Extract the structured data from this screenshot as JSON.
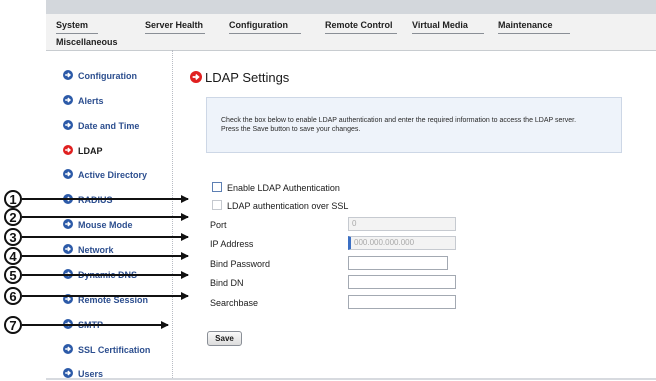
{
  "menu": {
    "items": [
      "System",
      "Server Health",
      "Configuration",
      "Remote Control",
      "Virtual Media",
      "Maintenance"
    ],
    "row2": [
      "Miscellaneous"
    ]
  },
  "sidebar": {
    "items": [
      {
        "label": "Configuration",
        "icon": "arrow-right-circle-icon"
      },
      {
        "label": "Alerts",
        "icon": "arrow-right-circle-icon"
      },
      {
        "label": "Date and Time",
        "icon": "arrow-right-circle-icon"
      },
      {
        "label": "LDAP",
        "icon": "arrow-right-circle-icon",
        "active": true
      },
      {
        "label": "Active Directory",
        "icon": "arrow-right-circle-icon"
      },
      {
        "label": "RADIUS",
        "icon": "arrow-right-circle-icon"
      },
      {
        "label": "Mouse Mode",
        "icon": "arrow-right-circle-icon"
      },
      {
        "label": "Network",
        "icon": "arrow-right-circle-icon"
      },
      {
        "label": "Dynamic DNS",
        "icon": "arrow-right-circle-icon"
      },
      {
        "label": "Remote Session",
        "icon": "arrow-right-circle-icon"
      },
      {
        "label": "SMTP",
        "icon": "arrow-right-circle-icon"
      },
      {
        "label": "SSL Certification",
        "icon": "arrow-right-circle-icon"
      },
      {
        "label": "Users",
        "icon": "arrow-right-circle-icon"
      }
    ]
  },
  "page": {
    "title": "LDAP Settings",
    "info_line1": "Check the box below to enable LDAP authentication and enter the required information to access the LDAP server.",
    "info_line2": "Press the Save button to save your changes."
  },
  "form": {
    "enable_ldap_label": "Enable LDAP Authentication",
    "ssl_label": "LDAP authentication over SSL",
    "port_label": "Port",
    "port_value": "0",
    "ip_label": "IP Address",
    "ip_value": "000.000.000.000",
    "bind_password_label": "Bind Password",
    "bind_dn_label": "Bind DN",
    "searchbase_label": "Searchbase",
    "save_label": "Save"
  },
  "callouts": [
    "1",
    "2",
    "3",
    "4",
    "5",
    "6",
    "7"
  ],
  "colors": {
    "nav_icon": "#2c5aa8",
    "active_icon": "#e02020",
    "nav_text": "#2d4f8f",
    "info_bg": "#eef3fa"
  }
}
